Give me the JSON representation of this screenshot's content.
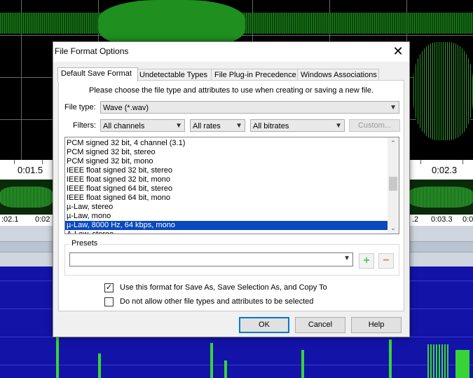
{
  "background": {
    "ruler_top": [
      "0:01.5",
      "0:02.3"
    ],
    "ruler_bottom": [
      ":02.1",
      "0:02",
      ".2",
      "0:03.3",
      "0:0"
    ]
  },
  "dialog": {
    "title": "File Format Options",
    "close_icon": "close-icon",
    "tabs": [
      {
        "label": "Default Save Format",
        "active": true
      },
      {
        "label": "Undetectable Types",
        "active": false
      },
      {
        "label": "File Plug-in Precedence",
        "active": false
      },
      {
        "label": "Windows Associations",
        "active": false
      }
    ],
    "instruction": "Please choose the file type and attributes to use when creating or saving a new file.",
    "file_type": {
      "label": "File type:",
      "value": "Wave (*.wav)"
    },
    "filters": {
      "label": "Filters:",
      "channels": "All channels",
      "rates": "All rates",
      "bitrates": "All bitrates",
      "custom_button": "Custom..."
    },
    "format_list": [
      {
        "label": "PCM signed 32 bit, 4 channel (3.1)",
        "selected": false
      },
      {
        "label": "PCM signed 32 bit, stereo",
        "selected": false
      },
      {
        "label": "PCM signed 32 bit, mono",
        "selected": false
      },
      {
        "label": "IEEE float signed 32 bit, stereo",
        "selected": false
      },
      {
        "label": "IEEE float signed 32 bit, mono",
        "selected": false
      },
      {
        "label": "IEEE float signed 64 bit, stereo",
        "selected": false
      },
      {
        "label": "IEEE float signed 64 bit, mono",
        "selected": false
      },
      {
        "label": "µ-Law, stereo",
        "selected": false
      },
      {
        "label": "µ-Law, mono",
        "selected": false
      },
      {
        "label": "µ-Law, 8000 Hz, 64 kbps, mono",
        "selected": true
      },
      {
        "label": "A-Law, stereo",
        "selected": false
      }
    ],
    "presets": {
      "label": "Presets",
      "value": "",
      "add_icon": "plus-icon",
      "remove_icon": "minus-icon"
    },
    "checkboxes": [
      {
        "label": "Use this format for Save As, Save Selection As, and Copy To",
        "checked": true
      },
      {
        "label": "Do not allow other file types and attributes to be selected",
        "checked": false
      }
    ],
    "buttons": {
      "ok": "OK",
      "cancel": "Cancel",
      "help": "Help"
    }
  }
}
